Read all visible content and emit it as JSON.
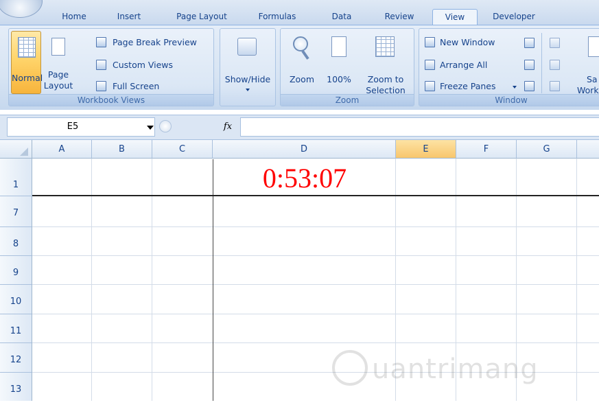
{
  "tabs": [
    "Home",
    "Insert",
    "Page Layout",
    "Formulas",
    "Data",
    "Review",
    "View",
    "Developer"
  ],
  "active_tab": "View",
  "ribbon": {
    "workbook_views": {
      "normal": "Normal",
      "page_layout_1": "Page",
      "page_layout_2": "Layout",
      "page_break_preview": "Page Break Preview",
      "custom_views": "Custom Views",
      "full_screen": "Full Screen",
      "label": "Workbook Views"
    },
    "show_hide": {
      "label": "Show/Hide"
    },
    "zoom": {
      "zoom": "Zoom",
      "hundred": "100%",
      "zoom_to_1": "Zoom to",
      "zoom_to_2": "Selection",
      "label": "Zoom"
    },
    "window": {
      "new_window": "New Window",
      "arrange_all": "Arrange All",
      "freeze_panes": "Freeze Panes",
      "save_ws_1": "Sa",
      "save_ws_2": "Work",
      "label": "Window"
    }
  },
  "formula_bar": {
    "name_box": "E5",
    "fx": "fx",
    "content": ""
  },
  "sheet": {
    "columns": [
      "A",
      "B",
      "C",
      "D",
      "E",
      "F",
      "G"
    ],
    "selected_column": "E",
    "rows": [
      "1",
      "7",
      "8",
      "9",
      "10",
      "11",
      "12",
      "13"
    ],
    "cell_D1": "0:53:07"
  },
  "colors": {
    "timer": "#ff0000",
    "selection": "#f8c66d",
    "ribbon": "#dbe7f5"
  },
  "watermark": "uantrimang"
}
